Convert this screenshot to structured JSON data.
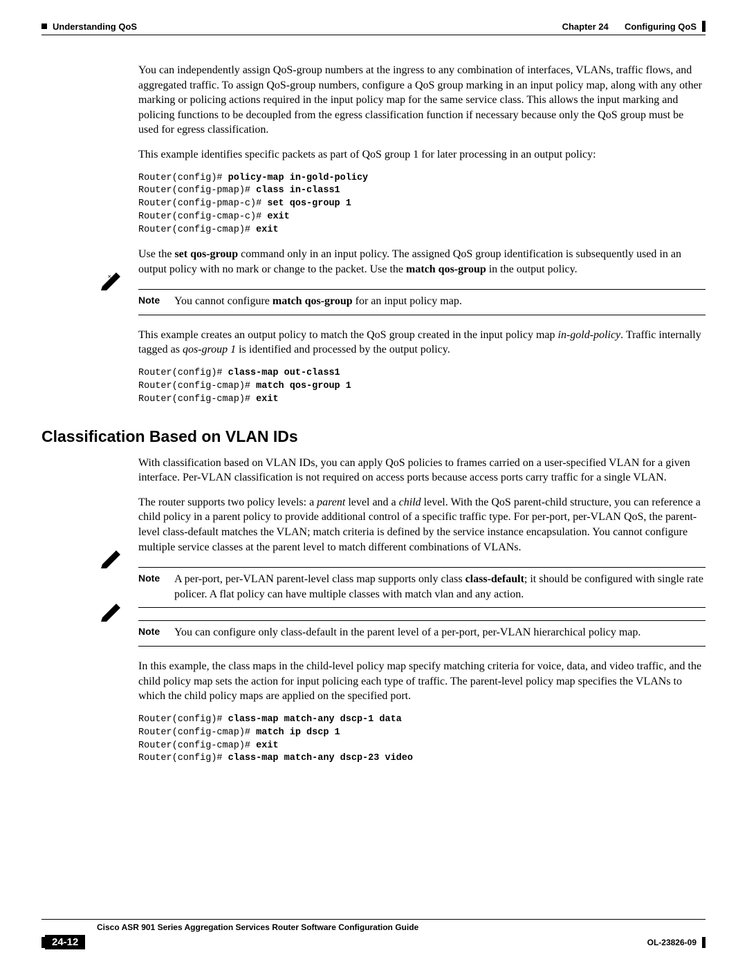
{
  "header": {
    "chapter": "Chapter 24",
    "chapterTitle": "Configuring QoS",
    "section": "Understanding QoS"
  },
  "body": {
    "p1": "You can independently assign QoS-group numbers at the ingress to any combination of interfaces, VLANs, traffic flows, and aggregated traffic. To assign QoS-group numbers, configure a QoS group marking in an input policy map, along with any other marking or policing actions required in the input policy map for the same service class. This allows the input marking and policing functions to be decoupled from the egress classification function if necessary because only the QoS group must be used for egress classification.",
    "p2": "This example identifies specific packets as part of QoS group 1 for later processing in an output policy:",
    "code1": {
      "l1p": "Router(config)# ",
      "l1b": "policy-map in-gold-policy",
      "l2p": "Router(config-pmap)# ",
      "l2b": "class in-class1",
      "l3p": "Router(config-pmap-c)# ",
      "l3b": "set qos-group 1",
      "l4p": "Router(config-cmap-c)# ",
      "l4b": "exit",
      "l5p": "Router(config-cmap)# ",
      "l5b": "exit"
    },
    "p3a": "Use the ",
    "p3b": "set qos-group",
    "p3c": " command only in an input policy. The assigned QoS group identification is subsequently used in an output policy with no mark or change to the packet. Use the ",
    "p3d": "match qos-group",
    "p3e": " in the output policy.",
    "note1": {
      "label": "Note",
      "t1": "You cannot configure ",
      "t2": "match qos-group",
      "t3": " for an input policy map."
    },
    "p4a": "This example creates an output policy to match the QoS group created in the input policy map ",
    "p4b": "in-gold-policy",
    "p4c": ". Traffic internally tagged as ",
    "p4d": "qos-group 1",
    "p4e": " is identified and processed by the output policy.",
    "code2": {
      "l1p": "Router(config)# ",
      "l1b": "class-map out-class1",
      "l2p": "Router(config-cmap)# ",
      "l2b": "match qos-group 1",
      "l3p": "Router(config-cmap)# ",
      "l3b": "exit"
    },
    "h2": "Classification Based on VLAN IDs",
    "p5": "With classification based on VLAN IDs, you can apply QoS policies to frames carried on a user-specified VLAN for a given interface. Per-VLAN classification is not required on access ports because access ports carry traffic for a single VLAN.",
    "p6a": "The router supports two policy levels: a ",
    "p6b": "parent",
    "p6c": " level and a ",
    "p6d": "child",
    "p6e": " level. With the QoS parent-child structure, you can reference a child policy in a parent policy to provide additional control of a specific traffic type. For per-port, per-VLAN QoS, the parent-level class-default matches the VLAN; match criteria is defined by the service instance encapsulation. You cannot configure multiple service classes at the parent level to match different combinations of VLANs.",
    "note2": {
      "label": "Note",
      "t1": "A per-port, per-VLAN parent-level class map supports only class ",
      "t2": "class-default",
      "t3": "; it should be configured with single rate policer. A flat policy can have multiple classes with match vlan and any action."
    },
    "note3": {
      "label": "Note",
      "text": "You can configure only class-default in the parent level of a per-port, per-VLAN hierarchical policy map."
    },
    "p7": "In this example, the class maps in the child-level policy map specify matching criteria for voice, data, and video traffic, and the child policy map sets the action for input policing each type of traffic. The parent-level policy map specifies the VLANs to which the child policy maps are applied on the specified port.",
    "code3": {
      "l1p": "Router(config)# ",
      "l1b": "class-map match-any dscp-1 data",
      "l2p": "Router(config-cmap)# ",
      "l2b": "match ip dscp 1",
      "l3p": "Router(config-cmap)# ",
      "l3b": "exit",
      "l4p": "Router(config)# ",
      "l4b": "class-map match-any dscp-23 video"
    }
  },
  "footer": {
    "guide": "Cisco ASR 901 Series Aggregation Services Router Software Configuration Guide",
    "page": "24-12",
    "doc": "OL-23826-09"
  }
}
